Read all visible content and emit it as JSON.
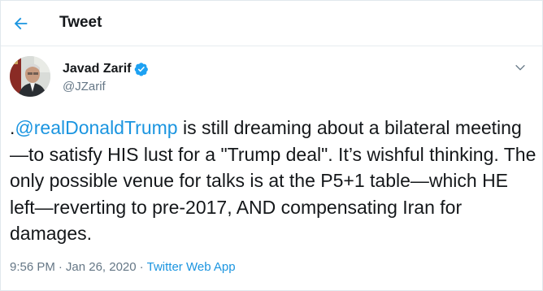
{
  "header": {
    "title": "Tweet"
  },
  "author": {
    "display_name": "Javad Zarif",
    "handle": "@JZarif",
    "verified": true
  },
  "tweet": {
    "mention": "@realDonaldTrump",
    "text_prefix": ".",
    "text_body": " is still dreaming about a bilateral meeting—to satisfy HIS lust for a \"Trump deal\". It’s wishful thinking. The only possible venue for talks is at the P5+1 table—which HE left—reverting to pre-2017, AND compensating Iran for damages."
  },
  "meta": {
    "time": "9:56 PM",
    "separator": "·",
    "date": "Jan 26, 2020",
    "source": "Twitter Web App"
  },
  "colors": {
    "accent": "#1b95e0",
    "text": "#14171a",
    "muted": "#657786"
  },
  "icons": {
    "back": "arrow-left-icon",
    "verified": "verified-badge-icon",
    "more": "chevron-down-icon"
  }
}
